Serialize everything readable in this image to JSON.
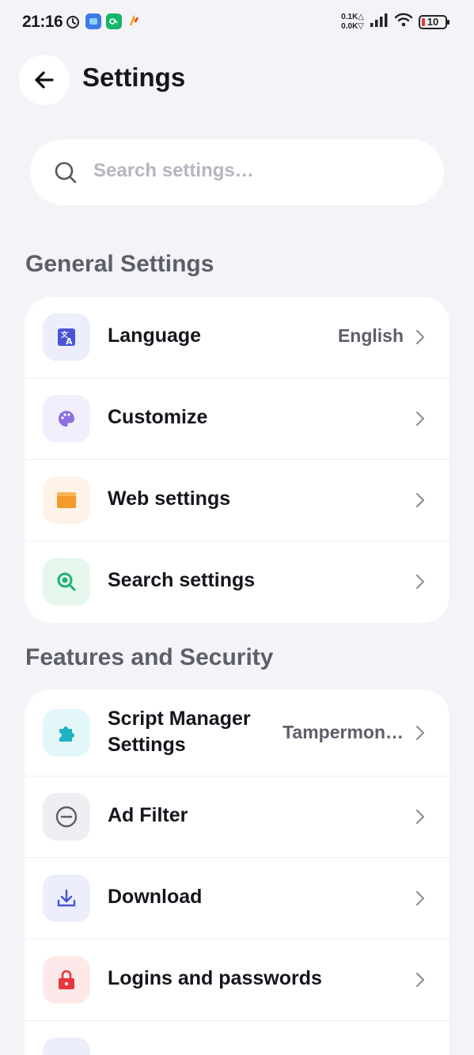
{
  "status_bar": {
    "time": "21:16",
    "net_up": "0.1K",
    "net_down": "0.0K",
    "battery": "10"
  },
  "header": {
    "title": "Settings"
  },
  "search": {
    "placeholder": "Search settings…"
  },
  "sections": [
    {
      "title": "General Settings",
      "items": [
        {
          "label": "Language",
          "value": "English",
          "icon": "translate-icon",
          "icon_bg": "#eceefc",
          "icon_color": "#4a55d6"
        },
        {
          "label": "Customize",
          "icon": "palette-icon",
          "icon_bg": "#f1effc",
          "icon_color": "#8c6fe0"
        },
        {
          "label": "Web settings",
          "icon": "browser-window-icon",
          "icon_bg": "#fff3e8",
          "icon_color": "#f39a2a"
        },
        {
          "label": "Search settings",
          "icon": "search-icon",
          "icon_bg": "#e6f7ee",
          "icon_color": "#1fb271"
        }
      ]
    },
    {
      "title": "Features and Security",
      "items": [
        {
          "label_line1": "Script Manager",
          "label_line2": "Settings",
          "value": "Tampermon…",
          "icon": "puzzle-icon",
          "icon_bg": "#e3f7f9",
          "icon_color": "#1fb3c2"
        },
        {
          "label": "Ad Filter",
          "icon": "minus-circle-icon",
          "icon_bg": "#efeff3",
          "icon_color": "#5c5f6a"
        },
        {
          "label": "Download",
          "icon": "download-icon",
          "icon_bg": "#eceefc",
          "icon_color": "#4a55d6"
        },
        {
          "label": "Logins and passwords",
          "icon": "lock-icon",
          "icon_bg": "#fde9ea",
          "icon_color": "#e8383d"
        },
        {
          "label": "",
          "icon": "partial-icon",
          "icon_bg": "#eceefc",
          "icon_color": "#4a55d6"
        }
      ]
    }
  ]
}
